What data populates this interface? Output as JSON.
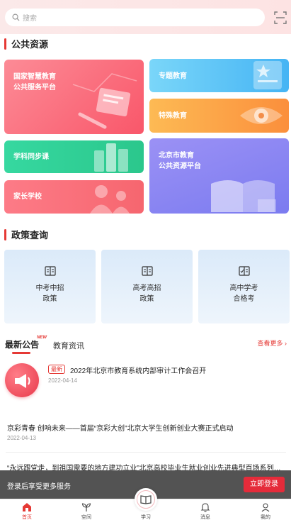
{
  "search": {
    "placeholder": "搜索"
  },
  "sections": {
    "public_resources": "公共资源",
    "policy_query": "政策查询"
  },
  "resources": {
    "national_platform": {
      "line1": "国家智慧教育",
      "line2": "公共服务平台"
    },
    "special_topic": "专题教育",
    "special_education": "特殊教育",
    "subject_sync": "学科同步课",
    "beijing_platform": {
      "line1": "北京市教育",
      "line2": "公共资源平台"
    },
    "parent_school": "家长学校"
  },
  "policies": [
    {
      "line1": "中考中招",
      "line2": "政策"
    },
    {
      "line1": "高考高招",
      "line2": "政策"
    },
    {
      "line1": "高中学考",
      "line2": "合格考"
    }
  ],
  "news": {
    "tab_active": "最新公告",
    "new_badge": "NEW",
    "tab_other": "教育资讯",
    "more": "查看更多",
    "items": [
      {
        "tag": "最新",
        "title": "2022年北京市教育系统内部审计工作会召开",
        "date": "2022-04-14"
      },
      {
        "title": "京彩青春 创响未来——首届“京彩大创”北京大学生创新创业大赛正式启动",
        "date": "2022-04-13"
      },
      {
        "title": "“永远跟党走，到祖国需要的地方建功立业”北京高校毕业生就业创业先进典型百场系列宣..."
      }
    ]
  },
  "login_banner": {
    "text": "登录后享受更多服务",
    "button": "立即登录"
  },
  "tabbar": [
    {
      "label": "首页",
      "icon": "home-icon",
      "active": true
    },
    {
      "label": "空间",
      "icon": "sprout-icon",
      "active": false
    },
    {
      "label": "学习",
      "icon": "book-icon",
      "active": false
    },
    {
      "label": "消息",
      "icon": "bell-icon",
      "active": false
    },
    {
      "label": "我的",
      "icon": "user-icon",
      "active": false
    }
  ],
  "colors": {
    "accent": "#e53935",
    "pink": "#fb6a7a",
    "blue": "#55c3f5",
    "orange": "#fba54a",
    "green": "#3ad69a",
    "purple": "#8a84f2"
  }
}
